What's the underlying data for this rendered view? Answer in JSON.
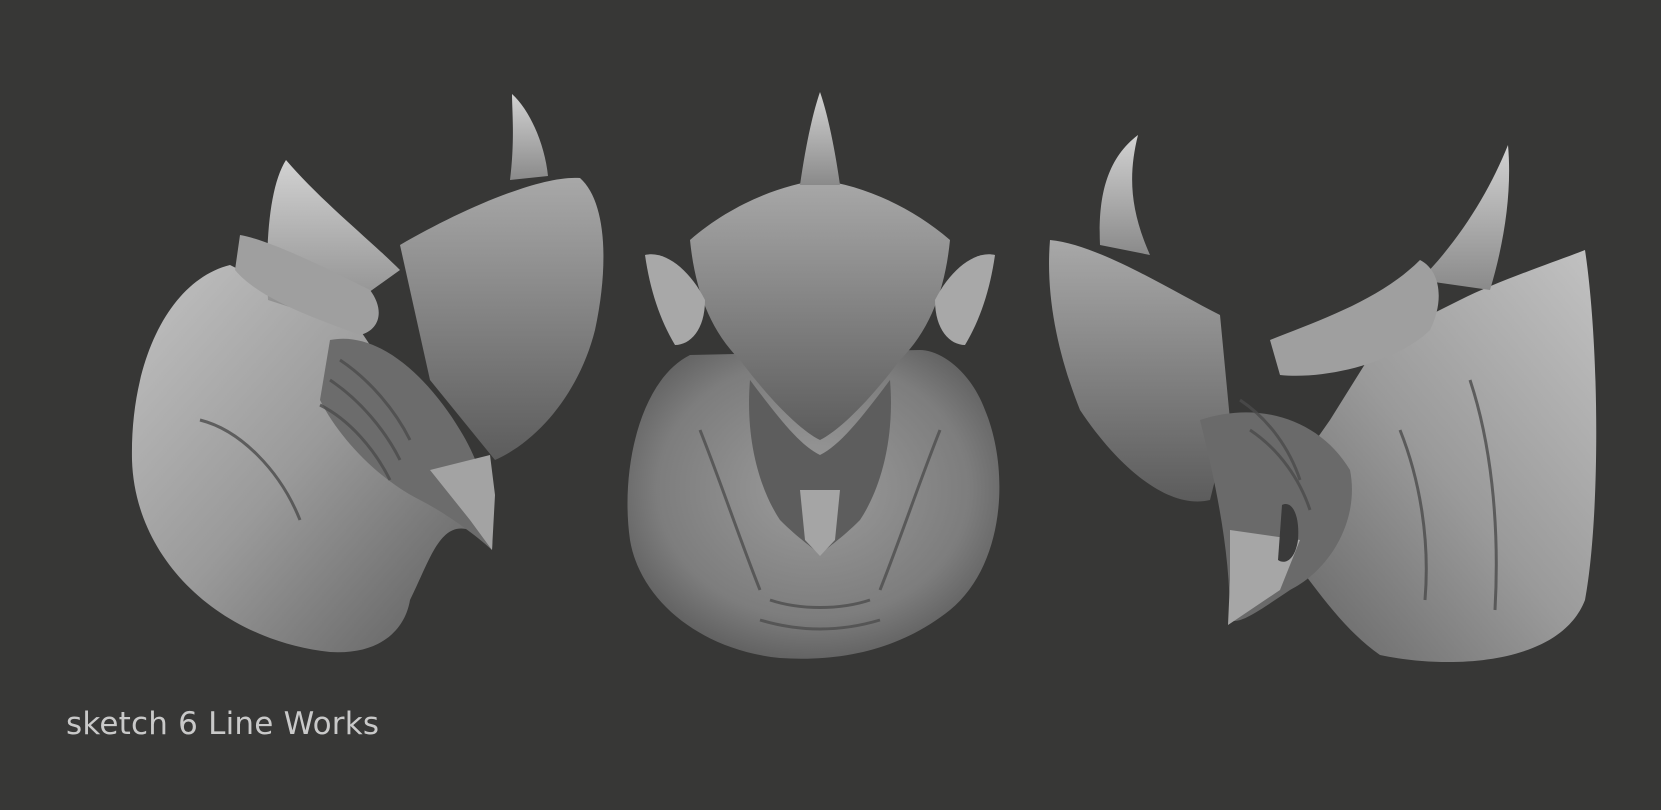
{
  "caption": "sketch 6 Line Works",
  "colors": {
    "background": "#373736",
    "sculpt_light": "#b9b9b9",
    "sculpt_mid": "#8e8e8e",
    "sculpt_dark": "#4f4f4f",
    "caption": "#c9c9c9"
  },
  "views": [
    {
      "name": "left three-quarter view"
    },
    {
      "name": "front view"
    },
    {
      "name": "right three-quarter view"
    }
  ]
}
